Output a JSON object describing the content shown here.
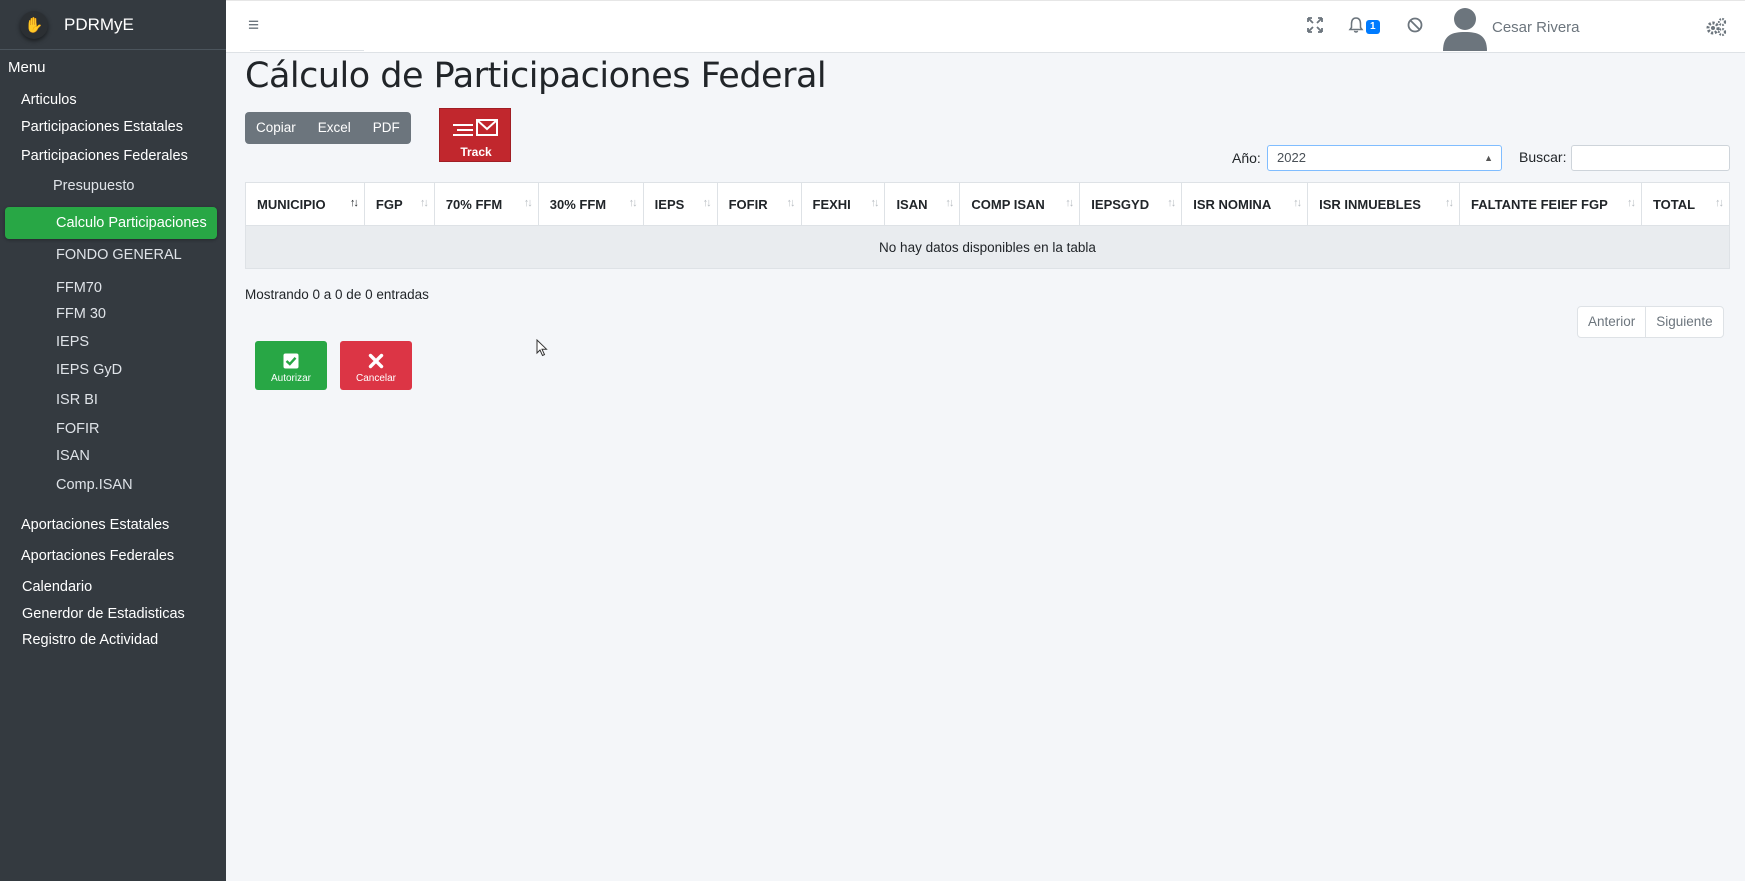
{
  "app": {
    "brand": "PDRMyE"
  },
  "sidebar": {
    "menu_header": "Menu",
    "items": [
      {
        "label": "Articulos"
      },
      {
        "label": "Participaciones Estatales"
      },
      {
        "label": "Participaciones Federales"
      },
      {
        "label": "Presupuesto"
      },
      {
        "label": "Calculo Participaciones",
        "active": true
      },
      {
        "label": "FONDO GENERAL"
      },
      {
        "label": "FFM70"
      },
      {
        "label": "FFM 30"
      },
      {
        "label": "IEPS"
      },
      {
        "label": "IEPS GyD"
      },
      {
        "label": "ISR BI"
      },
      {
        "label": "FOFIR"
      },
      {
        "label": "ISAN"
      },
      {
        "label": "Comp.ISAN"
      },
      {
        "label": "Aportaciones Estatales"
      },
      {
        "label": "Aportaciones Federales"
      },
      {
        "label": "Calendario"
      },
      {
        "label": "Generdor de Estadisticas"
      },
      {
        "label": "Registro de Actividad"
      }
    ]
  },
  "topbar": {
    "notification_count": "1",
    "user_name": "Cesar Rivera",
    "icons": [
      "menu-icon",
      "expand-icon",
      "bell-icon",
      "block-icon",
      "user-avatar",
      "gears-icon"
    ]
  },
  "page": {
    "title": "Cálculo de Participaciones Federal",
    "export_buttons": [
      "Copiar",
      "Excel",
      "PDF"
    ],
    "track_label": "Track",
    "year_label": "Año:",
    "year_value": "2022",
    "search_label": "Buscar:",
    "search_value": ""
  },
  "table": {
    "columns": [
      "MUNICIPIO",
      "FGP",
      "70% FFM",
      "30% FFM",
      "IEPS",
      "FOFIR",
      "FEXHI",
      "ISAN",
      "COMP ISAN",
      "IEPSGYD",
      "ISR NOMINA",
      "ISR INMUEBLES",
      "FALTANTE FEIEF FGP",
      "TOTAL"
    ],
    "sorted_column": "MUNICIPIO",
    "empty_message": "No hay datos disponibles en la tabla",
    "info": "Mostrando 0 a 0 de 0 entradas",
    "prev_label": "Anterior",
    "next_label": "Siguiente"
  },
  "actions": {
    "authorize_label": "Autorizar",
    "cancel_label": "Cancelar"
  },
  "colors": {
    "sidebar_bg": "#343a40",
    "active_item": "#28a745",
    "authorize": "#28a745",
    "cancel": "#dc3545",
    "track": "#c1272d",
    "badge": "#007bff"
  }
}
